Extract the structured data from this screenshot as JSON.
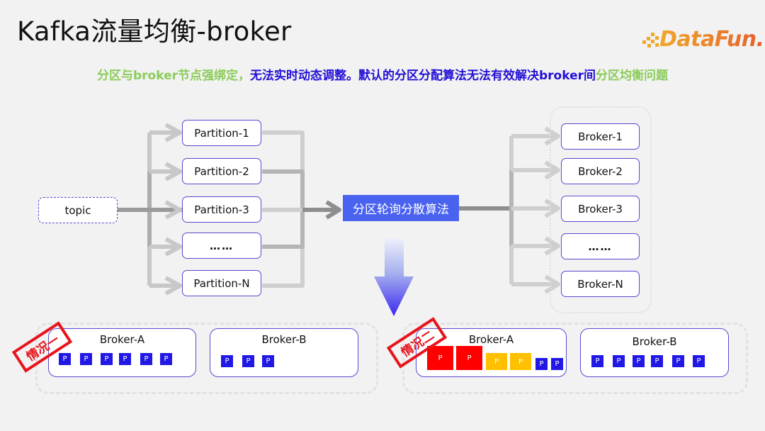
{
  "title": "Kafka流量均衡-broker",
  "logo": {
    "text": "DataFun."
  },
  "subtitle": {
    "part1": "分区与broker节点强绑定，",
    "part2": "无法实时动态调整。默认的分区分配算法无法有效解决broker间",
    "part3": "分区均衡问题"
  },
  "colors": {
    "green": "#8ccc5a",
    "blue": "#2310d6",
    "accent": "#4a62f0",
    "red": "#ff0000",
    "yellow": "#ffc000",
    "partition_blue": "#2118e6"
  },
  "diagram": {
    "topic": "topic",
    "partitions": [
      "Partition-1",
      "Partition-2",
      "Partition-3",
      "……",
      "Partition-N"
    ],
    "algorithm": "分区轮询分散算法",
    "brokers": [
      "Broker-1",
      "Broker-2",
      "Broker-3",
      "……",
      "Broker-N"
    ]
  },
  "cases": [
    {
      "label": "情况一",
      "brokers": [
        {
          "name": "Broker-A",
          "partitions": [
            "P",
            "P",
            "P",
            "P",
            "P",
            "P"
          ]
        },
        {
          "name": "Broker-B",
          "partitions": [
            "P",
            "P",
            "P"
          ]
        }
      ]
    },
    {
      "label": "情况二",
      "brokers": [
        {
          "name": "Broker-A",
          "partitions": [
            "P",
            "P",
            "P",
            "P",
            "P",
            "P"
          ],
          "partition_load": [
            "high",
            "high",
            "medium",
            "medium",
            "low",
            "low"
          ]
        },
        {
          "name": "Broker-B",
          "partitions": [
            "P",
            "P",
            "P",
            "P",
            "P",
            "P"
          ]
        }
      ]
    }
  ]
}
